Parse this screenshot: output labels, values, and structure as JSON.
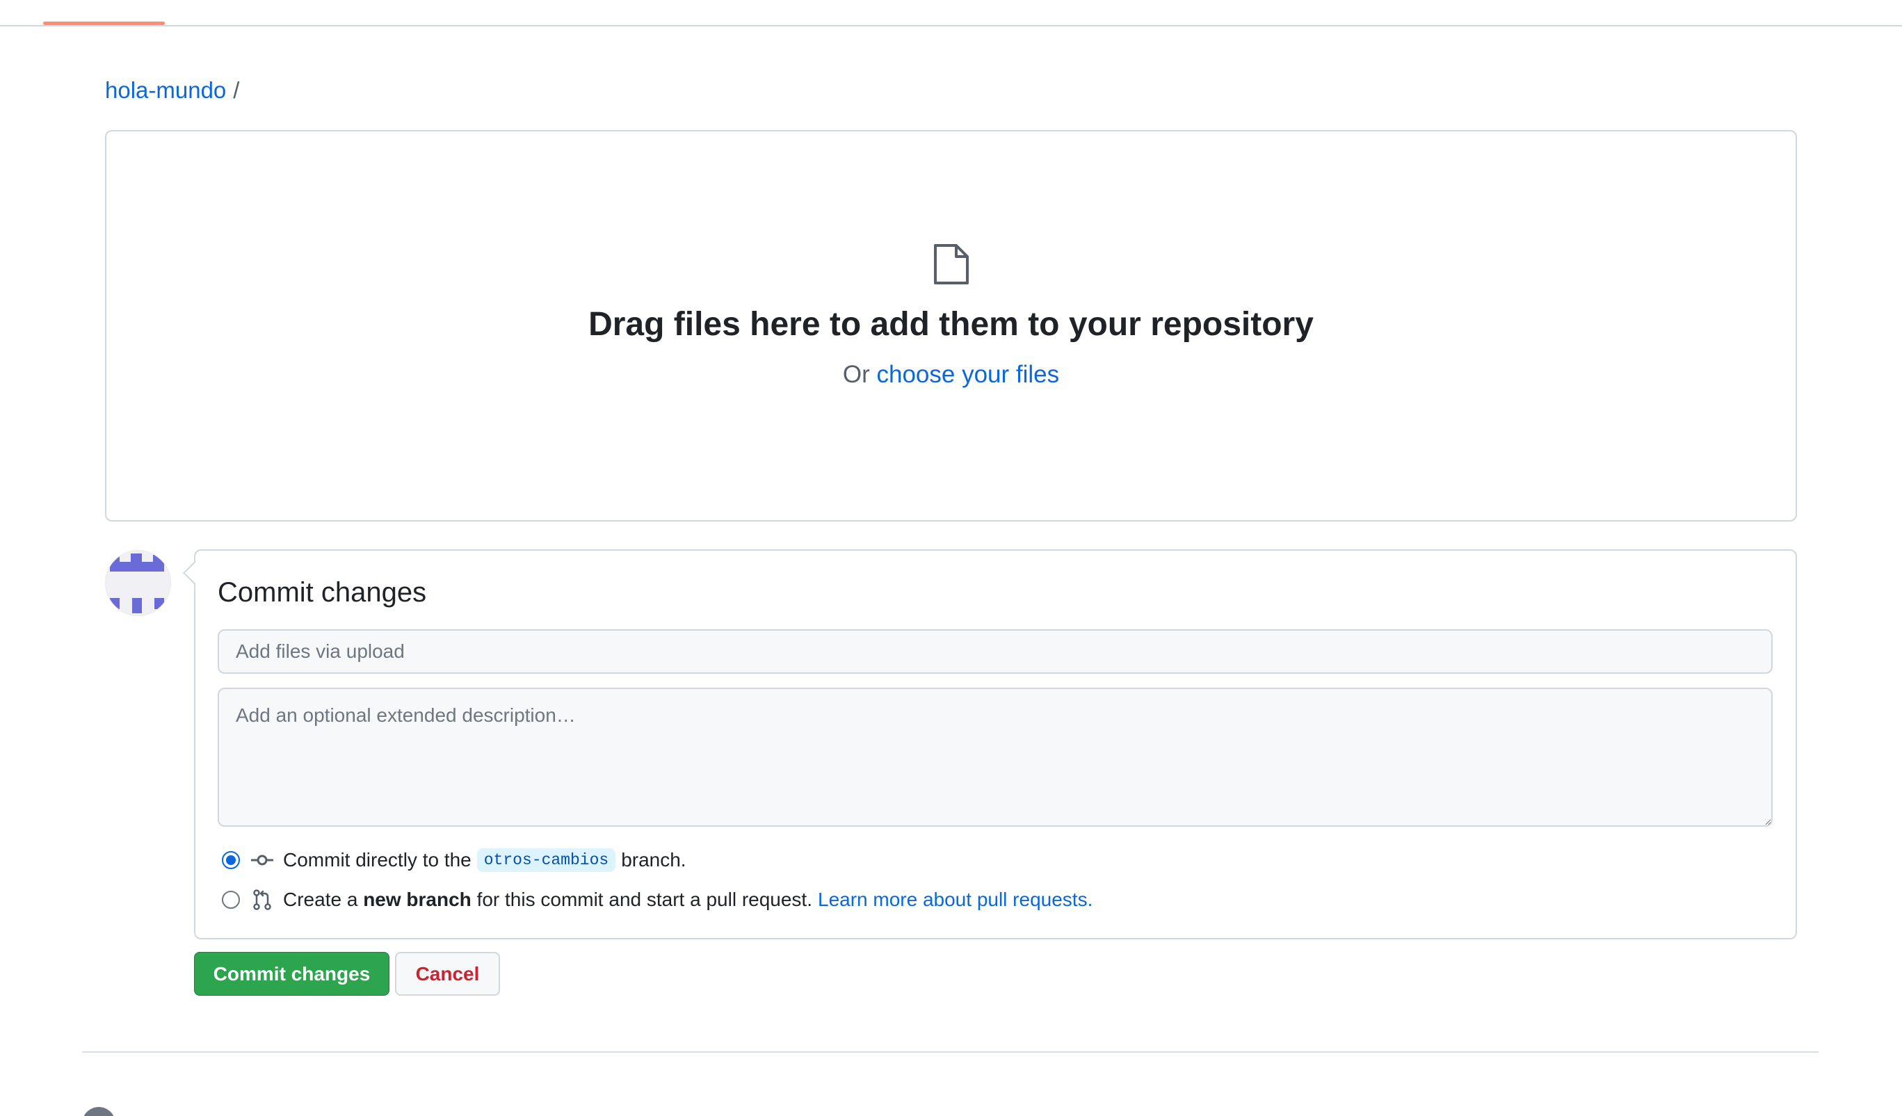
{
  "breadcrumb": {
    "repo": "hola-mundo",
    "separator": "/"
  },
  "dropzone": {
    "icon": "file-icon",
    "title": "Drag files here to add them to your repository",
    "prefix": "Or",
    "link": "choose your files"
  },
  "commit": {
    "title": "Commit changes",
    "summary_placeholder": "Add files via upload",
    "summary_value": "",
    "description_placeholder": "Add an optional extended description…",
    "description_value": "",
    "option_direct": {
      "selected": true,
      "icon": "git-commit-icon",
      "prefix": "Commit directly to the",
      "branch": "otros-cambios",
      "suffix": "branch."
    },
    "option_new_branch": {
      "selected": false,
      "icon": "git-pull-request-icon",
      "prefix": "Create a",
      "bold": "new branch",
      "suffix": "for this commit and start a pull request.",
      "link": "Learn more about pull requests."
    }
  },
  "buttons": {
    "commit": "Commit changes",
    "cancel": "Cancel"
  },
  "colors": {
    "link": "#0969da",
    "primary_button": "#2da44e",
    "danger_text": "#cf222e",
    "active_tab_underline": "#fd8c73",
    "avatar_identicon": "#6a6bd6"
  }
}
